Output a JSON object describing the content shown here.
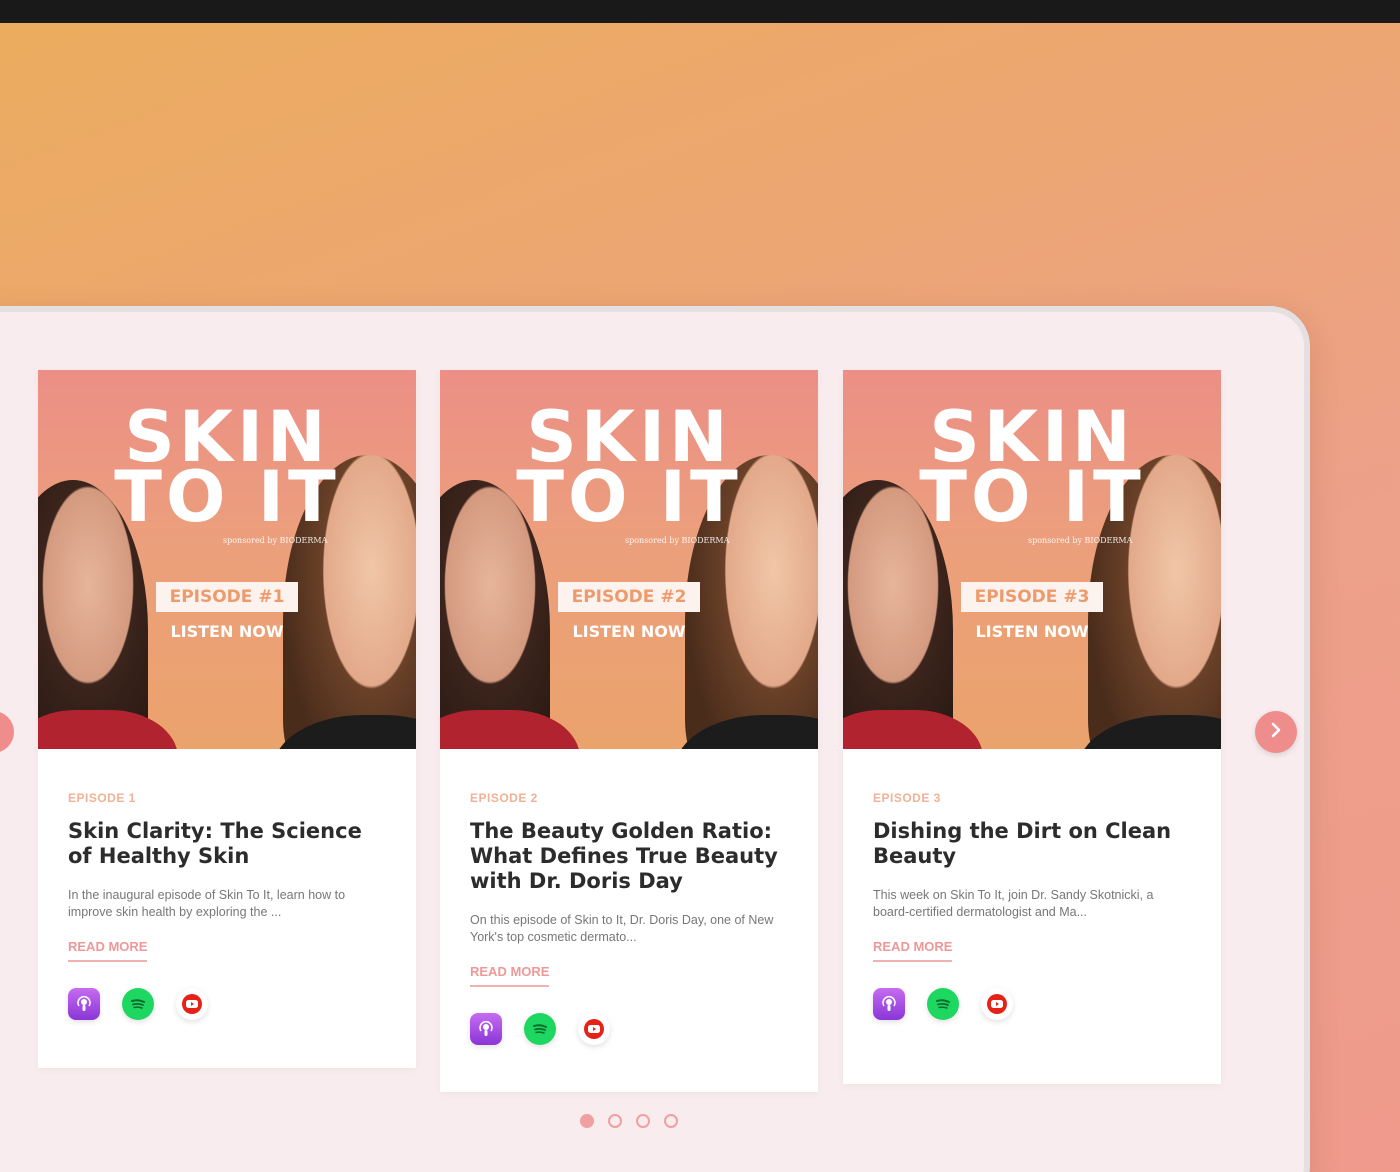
{
  "colors": {
    "accent": "#ef8c8c",
    "episode_label": "#efb295",
    "title": "#2c2c2c",
    "background_top": "#ebad5e",
    "background_bottom": "#ef9a8c"
  },
  "carousel": {
    "next_icon": "chevron-right-icon",
    "prev_icon": "chevron-left-icon",
    "pagination": {
      "total": 4,
      "active_index": 0
    }
  },
  "episodes": [
    {
      "thumb": {
        "logo_line1": "SKIN",
        "logo_line2": "TO IT",
        "sponsor": "sponsored by BIODERMA",
        "badge": "EPISODE #1",
        "cta": "LISTEN NOW"
      },
      "label": "EPISODE 1",
      "title": "Skin Clarity: The Science of Healthy Skin",
      "description": "In the inaugural episode of Skin To It, learn how to improve skin health by exploring the ...",
      "read_more": "READ MORE",
      "platforms": [
        "apple-podcasts-icon",
        "spotify-icon",
        "youtube-icon"
      ]
    },
    {
      "thumb": {
        "logo_line1": "SKIN",
        "logo_line2": "TO IT",
        "sponsor": "sponsored by BIODERMA",
        "badge": "EPISODE #2",
        "cta": "LISTEN NOW"
      },
      "label": "EPISODE 2",
      "title": "The Beauty Golden Ratio: What Defines True Beauty with Dr. Doris Day",
      "description": "On this episode of Skin to It, Dr. Doris Day, one of New York's top cosmetic dermato...",
      "read_more": "READ MORE",
      "platforms": [
        "apple-podcasts-icon",
        "spotify-icon",
        "youtube-icon"
      ]
    },
    {
      "thumb": {
        "logo_line1": "SKIN",
        "logo_line2": "TO IT",
        "sponsor": "sponsored by BIODERMA",
        "badge": "EPISODE #3",
        "cta": "LISTEN NOW"
      },
      "label": "EPISODE 3",
      "title": "Dishing the Dirt on Clean Beauty",
      "description": "This week on Skin To It, join Dr. Sandy Skotnicki, a board-certified dermatologist and Ma...",
      "read_more": "READ MORE",
      "platforms": [
        "apple-podcasts-icon",
        "spotify-icon",
        "youtube-icon"
      ]
    }
  ]
}
